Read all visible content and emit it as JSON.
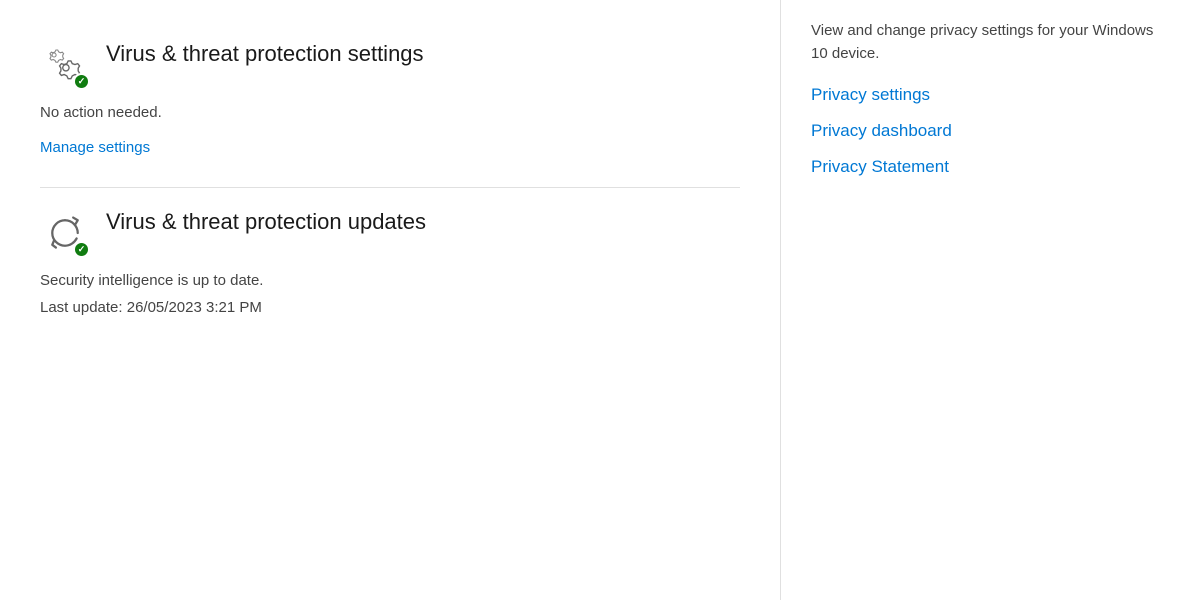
{
  "leftPanel": {
    "section1": {
      "title": "Virus & threat protection settings",
      "status": "No action needed.",
      "manageLink": "Manage settings",
      "icon": "settings"
    },
    "section2": {
      "title": "Virus & threat protection updates",
      "status": "Security intelligence is up to date.",
      "lastUpdate": "Last update: 26/05/2023 3:21 PM",
      "icon": "sync"
    }
  },
  "rightPanel": {
    "intro": "View and change privacy settings for your Windows 10 device.",
    "links": [
      {
        "label": "Privacy settings",
        "id": "privacy-settings"
      },
      {
        "label": "Privacy dashboard",
        "id": "privacy-dashboard"
      },
      {
        "label": "Privacy Statement",
        "id": "privacy-statement"
      }
    ]
  }
}
